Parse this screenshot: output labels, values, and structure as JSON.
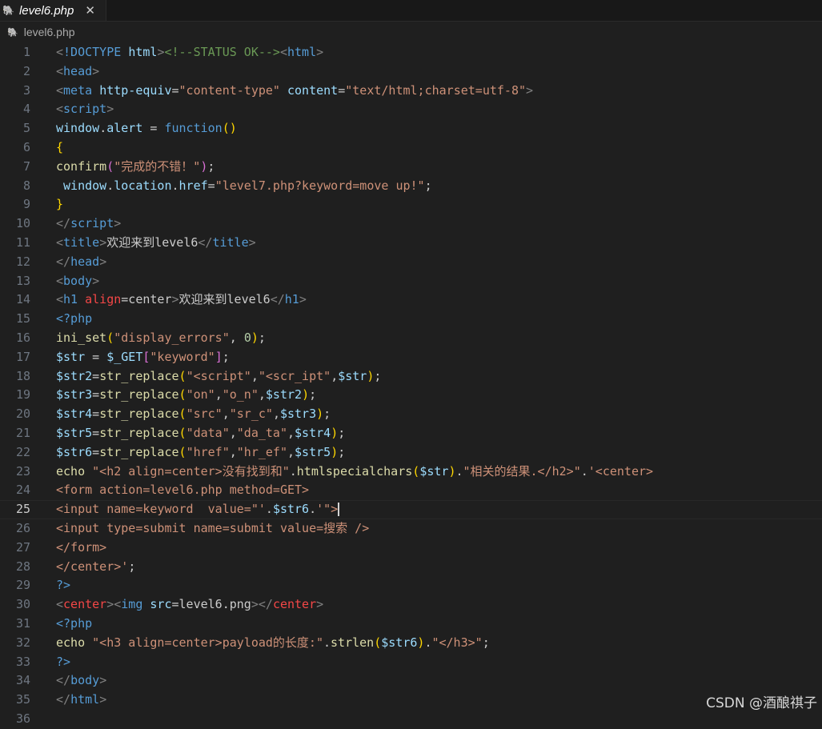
{
  "tab": {
    "label": "level6.php",
    "close": "✕",
    "icon": "php-elephant-icon"
  },
  "breadcrumb": {
    "file": "level6.php"
  },
  "editor": {
    "cursor_line": 25,
    "colors": {
      "tag": "#569cd6",
      "bracket": "#808080",
      "attr": "#9cdcfe",
      "str": "#ce9178",
      "var": "#9cdcfe",
      "fn": "#dcdcaa",
      "comment": "#6a9955",
      "num": "#b5cea8",
      "kw": "#569cd6",
      "text": "#cccccc",
      "red": "#f44747",
      "brace": "#ffd700",
      "paren2": "#da70d6",
      "meta": "#569cd6"
    },
    "lines": [
      {
        "n": "1",
        "t": [
          [
            "bracket",
            "<"
          ],
          [
            "meta",
            "!DOCTYPE"
          ],
          [
            "text",
            " "
          ],
          [
            "attr",
            "html"
          ],
          [
            "bracket",
            ">"
          ],
          [
            "comment",
            "<!--STATUS OK-->"
          ],
          [
            "bracket",
            "<"
          ],
          [
            "tag",
            "html"
          ],
          [
            "bracket",
            ">"
          ]
        ]
      },
      {
        "n": "2",
        "t": [
          [
            "bracket",
            "<"
          ],
          [
            "tag",
            "head"
          ],
          [
            "bracket",
            ">"
          ]
        ]
      },
      {
        "n": "3",
        "t": [
          [
            "bracket",
            "<"
          ],
          [
            "tag",
            "meta"
          ],
          [
            "text",
            " "
          ],
          [
            "attr",
            "http-equiv"
          ],
          [
            "text",
            "="
          ],
          [
            "str",
            "\"content-type\""
          ],
          [
            "text",
            " "
          ],
          [
            "attr",
            "content"
          ],
          [
            "text",
            "="
          ],
          [
            "str",
            "\"text/html;charset=utf-8\""
          ],
          [
            "bracket",
            ">"
          ]
        ]
      },
      {
        "n": "4",
        "t": [
          [
            "bracket",
            "<"
          ],
          [
            "tag",
            "script"
          ],
          [
            "bracket",
            ">"
          ]
        ]
      },
      {
        "n": "5",
        "t": [
          [
            "var",
            "window"
          ],
          [
            "text",
            "."
          ],
          [
            "var",
            "alert"
          ],
          [
            "text",
            " = "
          ],
          [
            "kw",
            "function"
          ],
          [
            "brace",
            "()"
          ]
        ]
      },
      {
        "n": "6",
        "t": [
          [
            "brace",
            "{"
          ]
        ]
      },
      {
        "n": "7",
        "t": [
          [
            "fn",
            "confirm"
          ],
          [
            "paren2",
            "("
          ],
          [
            "str",
            "\"完成的不错！\""
          ],
          [
            "paren2",
            ")"
          ],
          [
            "text",
            ";"
          ]
        ]
      },
      {
        "n": "8",
        "t": [
          [
            "text",
            " "
          ],
          [
            "var",
            "window"
          ],
          [
            "text",
            "."
          ],
          [
            "var",
            "location"
          ],
          [
            "text",
            "."
          ],
          [
            "var",
            "href"
          ],
          [
            "text",
            "="
          ],
          [
            "str",
            "\"level7.php?keyword=move up!\""
          ],
          [
            "text",
            ";"
          ]
        ]
      },
      {
        "n": "9",
        "t": [
          [
            "brace",
            "}"
          ]
        ]
      },
      {
        "n": "10",
        "t": [
          [
            "bracket",
            "</"
          ],
          [
            "tag",
            "script"
          ],
          [
            "bracket",
            ">"
          ]
        ]
      },
      {
        "n": "11",
        "t": [
          [
            "bracket",
            "<"
          ],
          [
            "tag",
            "title"
          ],
          [
            "bracket",
            ">"
          ],
          [
            "text",
            "欢迎来到level6"
          ],
          [
            "bracket",
            "</"
          ],
          [
            "tag",
            "title"
          ],
          [
            "bracket",
            ">"
          ]
        ]
      },
      {
        "n": "12",
        "t": [
          [
            "bracket",
            "</"
          ],
          [
            "tag",
            "head"
          ],
          [
            "bracket",
            ">"
          ]
        ]
      },
      {
        "n": "13",
        "t": [
          [
            "bracket",
            "<"
          ],
          [
            "tag",
            "body"
          ],
          [
            "bracket",
            ">"
          ]
        ]
      },
      {
        "n": "14",
        "t": [
          [
            "bracket",
            "<"
          ],
          [
            "tag",
            "h1"
          ],
          [
            "text",
            " "
          ],
          [
            "red",
            "align"
          ],
          [
            "text",
            "=center"
          ],
          [
            "bracket",
            ">"
          ],
          [
            "text",
            "欢迎来到level6"
          ],
          [
            "bracket",
            "</"
          ],
          [
            "tag",
            "h1"
          ],
          [
            "bracket",
            ">"
          ]
        ]
      },
      {
        "n": "15",
        "t": [
          [
            "kw",
            "<?php"
          ]
        ]
      },
      {
        "n": "16",
        "t": [
          [
            "fn",
            "ini_set"
          ],
          [
            "brace",
            "("
          ],
          [
            "str",
            "\"display_errors\""
          ],
          [
            "text",
            ", "
          ],
          [
            "num",
            "0"
          ],
          [
            "brace",
            ")"
          ],
          [
            "text",
            ";"
          ]
        ]
      },
      {
        "n": "17",
        "t": [
          [
            "var",
            "$str"
          ],
          [
            "text",
            " = "
          ],
          [
            "var",
            "$_GET"
          ],
          [
            "paren2",
            "["
          ],
          [
            "str",
            "\"keyword\""
          ],
          [
            "paren2",
            "]"
          ],
          [
            "text",
            ";"
          ]
        ]
      },
      {
        "n": "18",
        "t": [
          [
            "var",
            "$str2"
          ],
          [
            "text",
            "="
          ],
          [
            "fn",
            "str_replace"
          ],
          [
            "brace",
            "("
          ],
          [
            "str",
            "\"<script\""
          ],
          [
            "text",
            ","
          ],
          [
            "str",
            "\"<scr_ipt\""
          ],
          [
            "text",
            ","
          ],
          [
            "var",
            "$str"
          ],
          [
            "brace",
            ")"
          ],
          [
            "text",
            ";"
          ]
        ]
      },
      {
        "n": "19",
        "t": [
          [
            "var",
            "$str3"
          ],
          [
            "text",
            "="
          ],
          [
            "fn",
            "str_replace"
          ],
          [
            "brace",
            "("
          ],
          [
            "str",
            "\"on\""
          ],
          [
            "text",
            ","
          ],
          [
            "str",
            "\"o_n\""
          ],
          [
            "text",
            ","
          ],
          [
            "var",
            "$str2"
          ],
          [
            "brace",
            ")"
          ],
          [
            "text",
            ";"
          ]
        ]
      },
      {
        "n": "20",
        "t": [
          [
            "var",
            "$str4"
          ],
          [
            "text",
            "="
          ],
          [
            "fn",
            "str_replace"
          ],
          [
            "brace",
            "("
          ],
          [
            "str",
            "\"src\""
          ],
          [
            "text",
            ","
          ],
          [
            "str",
            "\"sr_c\""
          ],
          [
            "text",
            ","
          ],
          [
            "var",
            "$str3"
          ],
          [
            "brace",
            ")"
          ],
          [
            "text",
            ";"
          ]
        ]
      },
      {
        "n": "21",
        "t": [
          [
            "var",
            "$str5"
          ],
          [
            "text",
            "="
          ],
          [
            "fn",
            "str_replace"
          ],
          [
            "brace",
            "("
          ],
          [
            "str",
            "\"data\""
          ],
          [
            "text",
            ","
          ],
          [
            "str",
            "\"da_ta\""
          ],
          [
            "text",
            ","
          ],
          [
            "var",
            "$str4"
          ],
          [
            "brace",
            ")"
          ],
          [
            "text",
            ";"
          ]
        ]
      },
      {
        "n": "22",
        "t": [
          [
            "var",
            "$str6"
          ],
          [
            "text",
            "="
          ],
          [
            "fn",
            "str_replace"
          ],
          [
            "brace",
            "("
          ],
          [
            "str",
            "\"href\""
          ],
          [
            "text",
            ","
          ],
          [
            "str",
            "\"hr_ef\""
          ],
          [
            "text",
            ","
          ],
          [
            "var",
            "$str5"
          ],
          [
            "brace",
            ")"
          ],
          [
            "text",
            ";"
          ]
        ]
      },
      {
        "n": "23",
        "t": [
          [
            "fn",
            "echo"
          ],
          [
            "text",
            " "
          ],
          [
            "str",
            "\"<h2 align=center>没有找到和\""
          ],
          [
            "text",
            "."
          ],
          [
            "fn",
            "htmlspecialchars"
          ],
          [
            "brace",
            "("
          ],
          [
            "var",
            "$str"
          ],
          [
            "brace",
            ")"
          ],
          [
            "text",
            "."
          ],
          [
            "str",
            "\"相关的结果.</h2>\""
          ],
          [
            "text",
            "."
          ],
          [
            "str",
            "'<center>"
          ]
        ]
      },
      {
        "n": "24",
        "t": [
          [
            "str",
            "<form action=level6.php method=GET>"
          ]
        ]
      },
      {
        "n": "25",
        "t": [
          [
            "str",
            "<input name=keyword  value=\"'"
          ],
          [
            "text",
            "."
          ],
          [
            "var",
            "$str6"
          ],
          [
            "text",
            "."
          ],
          [
            "str",
            "'\">"
          ]
        ],
        "cursor": true
      },
      {
        "n": "26",
        "t": [
          [
            "str",
            "<input type=submit name=submit value=搜索 />"
          ]
        ]
      },
      {
        "n": "27",
        "t": [
          [
            "str",
            "</form>"
          ]
        ]
      },
      {
        "n": "28",
        "t": [
          [
            "str",
            "</center>'"
          ],
          [
            "text",
            ";"
          ]
        ]
      },
      {
        "n": "29",
        "t": [
          [
            "kw",
            "?>"
          ]
        ]
      },
      {
        "n": "30",
        "t": [
          [
            "bracket",
            "<"
          ],
          [
            "red",
            "center"
          ],
          [
            "bracket",
            "><"
          ],
          [
            "tag",
            "img"
          ],
          [
            "text",
            " "
          ],
          [
            "attr",
            "src"
          ],
          [
            "text",
            "=level6.png"
          ],
          [
            "bracket",
            "></"
          ],
          [
            "red",
            "center"
          ],
          [
            "bracket",
            ">"
          ]
        ]
      },
      {
        "n": "31",
        "t": [
          [
            "kw",
            "<?php"
          ]
        ]
      },
      {
        "n": "32",
        "t": [
          [
            "fn",
            "echo"
          ],
          [
            "text",
            " "
          ],
          [
            "str",
            "\"<h3 align=center>payload的长度:\""
          ],
          [
            "text",
            "."
          ],
          [
            "fn",
            "strlen"
          ],
          [
            "brace",
            "("
          ],
          [
            "var",
            "$str6"
          ],
          [
            "brace",
            ")"
          ],
          [
            "text",
            "."
          ],
          [
            "str",
            "\"</h3>\""
          ],
          [
            "text",
            ";"
          ]
        ]
      },
      {
        "n": "33",
        "t": [
          [
            "kw",
            "?>"
          ]
        ]
      },
      {
        "n": "34",
        "t": [
          [
            "bracket",
            "</"
          ],
          [
            "tag",
            "body"
          ],
          [
            "bracket",
            ">"
          ]
        ]
      },
      {
        "n": "35",
        "t": [
          [
            "bracket",
            "</"
          ],
          [
            "tag",
            "html"
          ],
          [
            "bracket",
            ">"
          ]
        ]
      },
      {
        "n": "36",
        "t": []
      }
    ]
  },
  "watermark": "CSDN @酒酿祺子"
}
